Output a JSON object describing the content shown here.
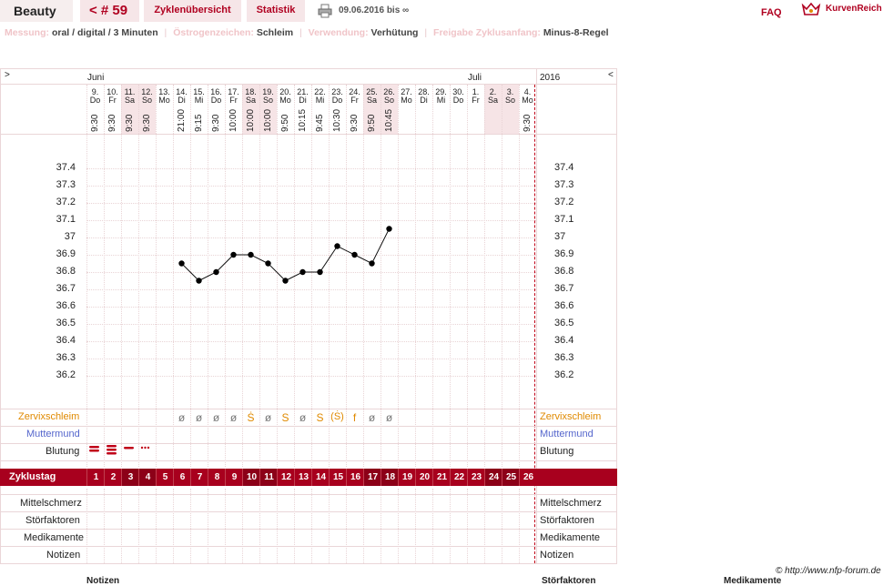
{
  "nav": {
    "title": "Beauty",
    "cycle_number": "< # 59",
    "tab_overview": "Zyklenübersicht",
    "tab_stats": "Statistik",
    "date_range": "09.06.2016 bis ∞",
    "faq": "FAQ",
    "logo_text": "KurvenReich"
  },
  "info": {
    "measurement_label": "Messung:",
    "measurement_value": "oral / digital / 3 Minuten",
    "estrogen_label": "Östrogenzeichen:",
    "estrogen_value": "Schleim",
    "usage_label": "Verwendung:",
    "usage_value": "Verhütung",
    "release_label": "Freigabe Zyklusanfang:",
    "release_value": "Minus-8-Regel"
  },
  "chart": {
    "nav_left": ">",
    "nav_right": "<",
    "month_june": "Juni",
    "month_july": "Juli",
    "year": "2016",
    "days": [
      {
        "d": "9.",
        "w": "Do",
        "t": "9:30"
      },
      {
        "d": "10.",
        "w": "Fr",
        "t": "9:30"
      },
      {
        "d": "11.",
        "w": "Sa",
        "t": "9:30"
      },
      {
        "d": "12.",
        "w": "So",
        "t": "9:30"
      },
      {
        "d": "13.",
        "w": "Mo",
        "t": ""
      },
      {
        "d": "14.",
        "w": "Di",
        "t": "21:00"
      },
      {
        "d": "15.",
        "w": "Mi",
        "t": "9:15"
      },
      {
        "d": "16.",
        "w": "Do",
        "t": "9:30"
      },
      {
        "d": "17.",
        "w": "Fr",
        "t": "10:00"
      },
      {
        "d": "18.",
        "w": "Sa",
        "t": "10:00"
      },
      {
        "d": "19.",
        "w": "So",
        "t": "10:00"
      },
      {
        "d": "20.",
        "w": "Mo",
        "t": "9:50"
      },
      {
        "d": "21.",
        "w": "Di",
        "t": "10:15"
      },
      {
        "d": "22.",
        "w": "Mi",
        "t": "9:45"
      },
      {
        "d": "23.",
        "w": "Do",
        "t": "10:30"
      },
      {
        "d": "24.",
        "w": "Fr",
        "t": "9:30"
      },
      {
        "d": "25.",
        "w": "Sa",
        "t": "9:50"
      },
      {
        "d": "26.",
        "w": "So",
        "t": "10:45"
      },
      {
        "d": "27.",
        "w": "Mo",
        "t": ""
      },
      {
        "d": "28.",
        "w": "Di",
        "t": ""
      },
      {
        "d": "29.",
        "w": "Mi",
        "t": ""
      },
      {
        "d": "30.",
        "w": "Do",
        "t": ""
      },
      {
        "d": "1.",
        "w": "Fr",
        "t": ""
      },
      {
        "d": "2.",
        "w": "Sa",
        "t": ""
      },
      {
        "d": "3.",
        "w": "So",
        "t": ""
      },
      {
        "d": "4.",
        "w": "Mo",
        "t": "9:30"
      }
    ],
    "y_ticks": [
      "37.4",
      "37.3",
      "37.2",
      "37.1",
      "37",
      "36.9",
      "36.8",
      "36.7",
      "36.6",
      "36.5",
      "36.4",
      "36.3",
      "36.2"
    ],
    "mucus": [
      "",
      "",
      "",
      "",
      "",
      "ø",
      "ø",
      "ø",
      "ø",
      "Ṡ",
      "ø",
      "S",
      "ø",
      "S",
      "(Ṡ)",
      "f",
      "ø",
      "ø",
      "",
      "",
      "",
      "",
      "",
      "",
      "",
      ""
    ],
    "labels": {
      "cervical": "Zervixschleim",
      "cervix": "Muttermund",
      "bleeding": "Blutung",
      "cycle_day": "Zyklustag",
      "mittelschmerz": "Mittelschmerz",
      "stoerfaktoren": "Störfaktoren",
      "medikamente": "Medikamente",
      "notizen": "Notizen"
    },
    "footer": "© http://www.nfp-forum.de",
    "bottom_notes": "Notizen",
    "bottom_stoer": "Störfaktoren",
    "bottom_medi": "Medikamente"
  },
  "chart_data": {
    "type": "line",
    "x": [
      "9.",
      "10.",
      "11.",
      "12.",
      "13.",
      "14.",
      "15.",
      "16.",
      "17.",
      "18.",
      "19.",
      "20.",
      "21.",
      "22.",
      "23.",
      "24.",
      "25.",
      "26.",
      "27.",
      "28.",
      "29.",
      "30.",
      "1.",
      "2.",
      "3.",
      "4."
    ],
    "series": [
      {
        "values": [
          null,
          null,
          null,
          null,
          null,
          36.85,
          36.75,
          36.8,
          36.9,
          36.9,
          36.85,
          36.75,
          36.8,
          36.8,
          36.95,
          36.9,
          36.85,
          37.05,
          null,
          null,
          null,
          null,
          null,
          null,
          null,
          null
        ]
      }
    ],
    "ylim": [
      36.2,
      37.4
    ],
    "grid": true
  },
  "colors": {
    "accent": "#a8001e",
    "mucus": "#e08a00",
    "cervix": "#5566cc"
  }
}
